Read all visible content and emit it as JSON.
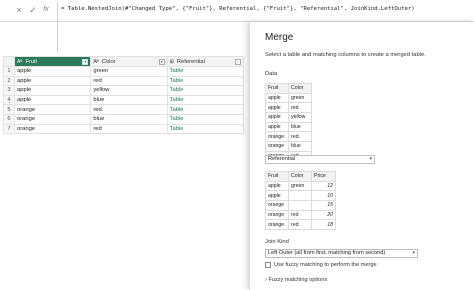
{
  "formula_bar": {
    "close_icon": "×",
    "check_icon": "✓",
    "fx_label": "fx",
    "formula": "= Table.NestedJoin(#\"Changed Type\", {\"Fruit\"}, Referential, {\"Fruit\"}, \"Referential\", JoinKind.LeftOuter)"
  },
  "grid": {
    "columns": [
      {
        "type_icon": "Aᴮ",
        "label": "Fruit"
      },
      {
        "type_icon": "Aᴮ",
        "label": "Color"
      },
      {
        "type_icon": "⊞",
        "label": "Referential"
      }
    ],
    "rows": [
      {
        "n": "1",
        "fruit": "apple",
        "color": "green",
        "ref": "Table"
      },
      {
        "n": "2",
        "fruit": "apple",
        "color": "red",
        "ref": "Table"
      },
      {
        "n": "3",
        "fruit": "apple",
        "color": "yellow",
        "ref": "Table"
      },
      {
        "n": "4",
        "fruit": "apple",
        "color": "blue",
        "ref": "Table"
      },
      {
        "n": "5",
        "fruit": "orange",
        "color": "red.",
        "ref": "Table"
      },
      {
        "n": "6",
        "fruit": "orange",
        "color": "blue",
        "ref": "Table"
      },
      {
        "n": "7",
        "fruit": "orange",
        "color": "red",
        "ref": "Table"
      }
    ]
  },
  "dialog": {
    "title": "Merge",
    "subtitle": "Select a table and matching columns to create a merged table.",
    "data_label": "Data",
    "data_table": {
      "headers": [
        "Fruit",
        "Color"
      ],
      "rows": [
        [
          "apple",
          "green"
        ],
        [
          "apple",
          "red"
        ],
        [
          "apple",
          "yellow"
        ],
        [
          "apple",
          "blue"
        ],
        [
          "orange",
          "red."
        ],
        [
          "orange",
          "blue"
        ],
        [
          "orange",
          "red"
        ]
      ]
    },
    "second_table_select": "Referential",
    "ref_table": {
      "headers": [
        "Fruit",
        "Color",
        "Price"
      ],
      "rows": [
        [
          "apple",
          "green",
          "12"
        ],
        [
          "apple",
          "",
          "10"
        ],
        [
          "orange",
          "",
          "15"
        ],
        [
          "orange",
          "red",
          "20"
        ],
        [
          "orange",
          "red",
          "18"
        ]
      ]
    },
    "join_kind_label": "Join Kind",
    "join_kind_value": "Left Outer (all from first, matching from second)",
    "fuzzy_checkbox_label": "Use fuzzy matching to perform the merge",
    "fuzzy_options_label": "Fuzzy matching options"
  }
}
